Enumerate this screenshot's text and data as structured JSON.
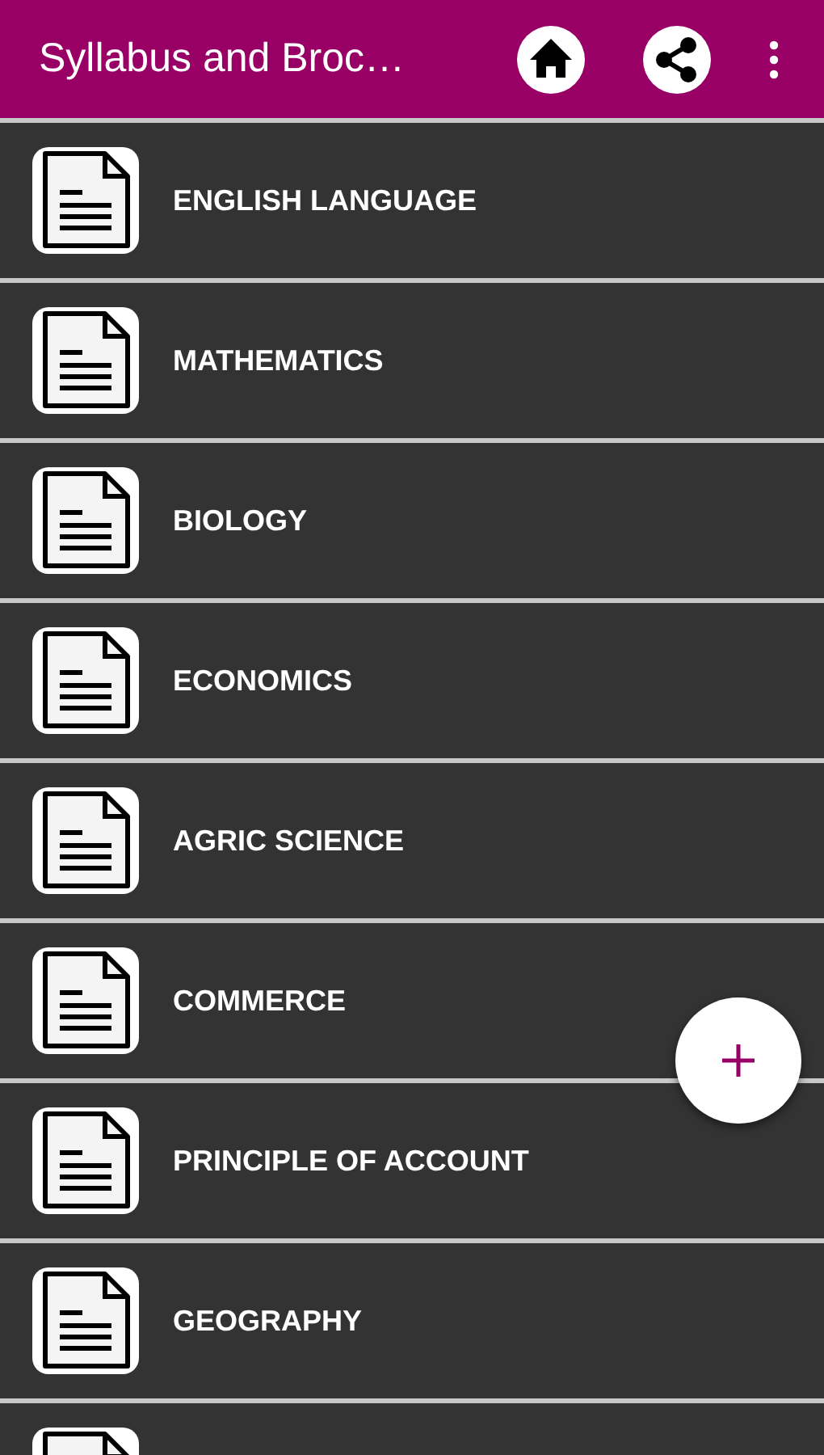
{
  "app_bar": {
    "title": "Syllabus and Broc…"
  },
  "subjects": [
    {
      "label": "ENGLISH LANGUAGE"
    },
    {
      "label": "MATHEMATICS"
    },
    {
      "label": "BIOLOGY"
    },
    {
      "label": "ECONOMICS"
    },
    {
      "label": "AGRIC SCIENCE"
    },
    {
      "label": "COMMERCE"
    },
    {
      "label": "PRINCIPLE OF ACCOUNT"
    },
    {
      "label": "GEOGRAPHY"
    }
  ]
}
